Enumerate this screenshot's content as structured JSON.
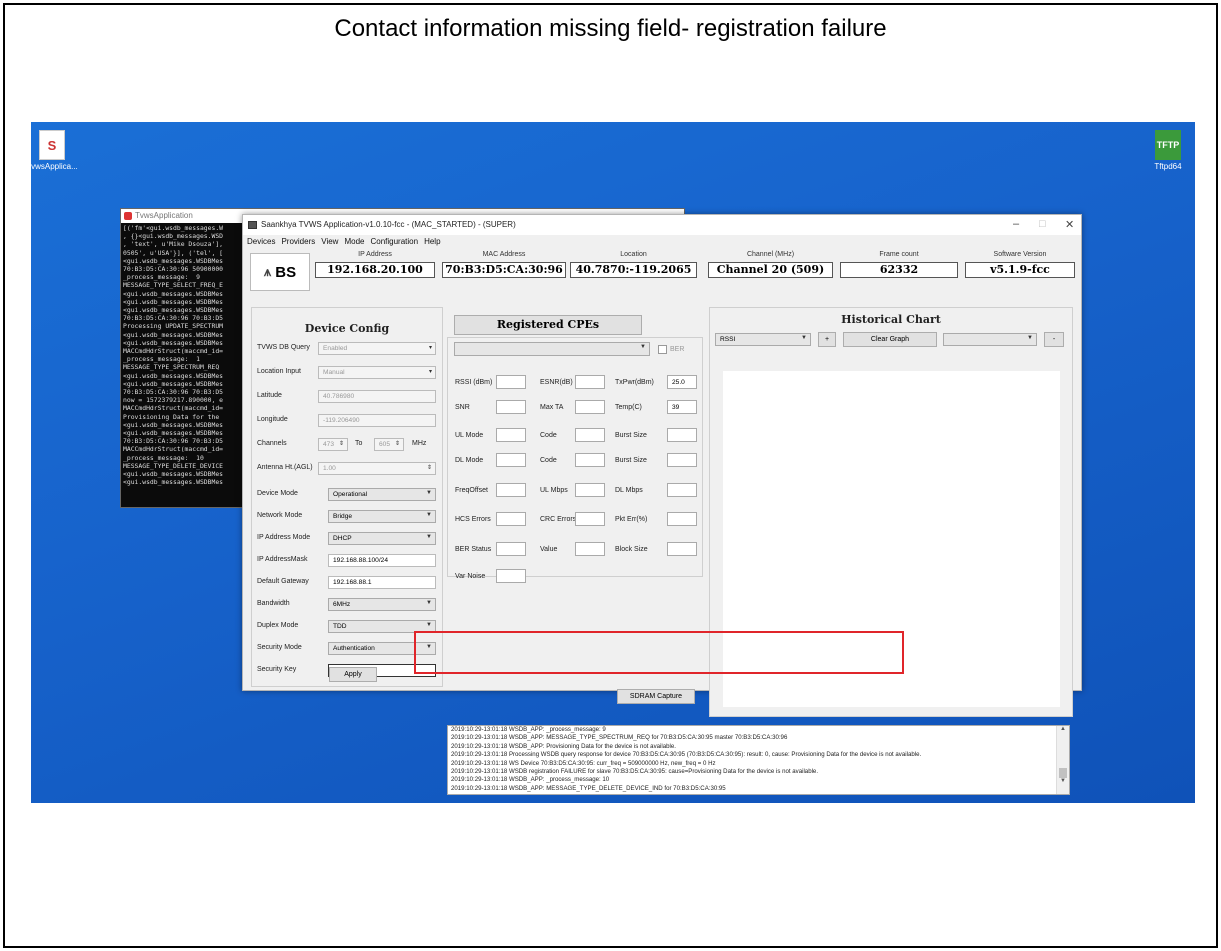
{
  "slide_title": "Contact information missing field- registration failure",
  "desktop": {
    "icons": [
      {
        "label": "TvwsApplica...",
        "icon": "app-icon"
      },
      {
        "label": "Tftpd64",
        "icon": "tftp-icon"
      }
    ]
  },
  "console": {
    "title": "TvwsApplication",
    "lines": [
      "[('fm'<gui.wsdb_messages.W",
      ", {}<gui.wsdb_messages.WSD",
      ", 'text', u'Mike Dsouza'],",
      "0505', u'USA'}], ('tel', [",
      "<gui.wsdb_messages.WSDBMes",
      "70:B3:D5:CA:30:96 50900000",
      "_process_message:  9",
      "MESSAGE_TYPE_SELECT_FREQ_E",
      "<gui.wsdb_messages.WSDBMes",
      "<gui.wsdb_messages.WSDBMes",
      "<gui.wsdb_messages.WSDBMes",
      "70:B3:D5:CA:30:96 70:B3:D5",
      "Processing UPDATE_SPECTRUM",
      "<gui.wsdb_messages.WSDBMes",
      "<gui.wsdb_messages.WSDBMes",
      "MACCmdHdrStruct(maccmd_id=",
      "_process_message:  1",
      "MESSAGE_TYPE_SPECTRUM_REQ",
      "<gui.wsdb_messages.WSDBMes",
      "<gui.wsdb_messages.WSDBMes",
      "70:B3:D5:CA:30:96 70:B3:D5",
      "now = 1572379217.890000, e",
      "MACCmdHdrStruct(maccmd_id=",
      "Provisioning Data for the",
      "<gui.wsdb_messages.WSDBMes",
      "<gui.wsdb_messages.WSDBMes",
      "70:B3:D5:CA:30:96 70:B3:D5",
      "MACCmdHdrStruct(maccmd_id=",
      "_process_message:  10",
      "MESSAGE_TYPE_DELETE_DEVICE",
      "<gui.wsdb_messages.WSDBMes",
      "<gui.wsdb_messages.WSDBMes"
    ]
  },
  "app": {
    "window_title": "Saankhya TVWS Application-v1.0.10-fcc - (MAC_STARTED) - (SUPER)",
    "window_controls": {
      "minimize": "–",
      "maximize": "□",
      "close": "✕"
    },
    "menu": [
      "Devices",
      "Providers",
      "View",
      "Mode",
      "Configuration",
      "Help"
    ],
    "logo_text": "BS",
    "header": [
      {
        "label": "IP Address",
        "value": "192.168.20.100"
      },
      {
        "label": "MAC Address",
        "value": "70:B3:D5:CA:30:96"
      },
      {
        "label": "Location",
        "value": "40.7870:-119.2065"
      },
      {
        "label": "Channel (MHz)",
        "value": "Channel 20 (509)"
      },
      {
        "label": "Frame count",
        "value": "62332"
      },
      {
        "label": "Software Version",
        "value": "v5.1.9-fcc"
      }
    ],
    "device_config": {
      "title": "Device Config",
      "tvws_db_query": {
        "label": "TVWS DB Query",
        "value": "Enabled"
      },
      "location_input": {
        "label": "Location Input",
        "value": "Manual"
      },
      "latitude": {
        "label": "Latitude",
        "value": "40.786980"
      },
      "longitude": {
        "label": "Longitude",
        "value": "-119.206490"
      },
      "channels": {
        "label": "Channels",
        "from": "473",
        "to_label": "To",
        "to": "605",
        "unit": "MHz"
      },
      "antenna": {
        "label": "Antenna Ht.(AGL)",
        "value": "1.00"
      },
      "device_mode": {
        "label": "Device Mode",
        "value": "Operational"
      },
      "network_mode": {
        "label": "Network Mode",
        "value": "Bridge"
      },
      "ip_address_mode": {
        "label": "IP Address Mode",
        "value": "DHCP"
      },
      "ip_address_mask": {
        "label": "IP AddressMask",
        "value": "192.168.88.100/24"
      },
      "default_gateway": {
        "label": "Default Gateway",
        "value": "192.168.88.1"
      },
      "bandwidth": {
        "label": "Bandwidth",
        "value": "6MHz"
      },
      "duplex_mode": {
        "label": "Duplex Mode",
        "value": "TDD"
      },
      "security_mode": {
        "label": "Security Mode",
        "value": "Authentication"
      },
      "security_key": {
        "label": "Security Key",
        "value": "••••••••"
      },
      "apply": "Apply"
    },
    "registered_cpes": {
      "title": "Registered CPEs",
      "ber_label": "BER",
      "stats": {
        "rssi": {
          "label": "RSSI (dBm)",
          "value": ""
        },
        "esnr": {
          "label": "ESNR(dB)",
          "value": ""
        },
        "txpwr": {
          "label": "TxPwr(dBm)",
          "value": "25.0"
        },
        "snr": {
          "label": "SNR",
          "value": ""
        },
        "max_ta": {
          "label": "Max TA",
          "value": ""
        },
        "temp": {
          "label": "Temp(C)",
          "value": "39"
        },
        "ul_mode": {
          "label": "UL Mode",
          "value": ""
        },
        "ul_code": {
          "label": "Code",
          "value": ""
        },
        "ul_burst": {
          "label": "Burst Size",
          "value": ""
        },
        "dl_mode": {
          "label": "DL Mode",
          "value": ""
        },
        "dl_code": {
          "label": "Code",
          "value": ""
        },
        "dl_burst": {
          "label": "Burst Size",
          "value": ""
        },
        "freq_offset": {
          "label": "FreqOffset",
          "value": ""
        },
        "ul_mbps": {
          "label": "UL Mbps",
          "value": ""
        },
        "dl_mbps": {
          "label": "DL Mbps",
          "value": ""
        },
        "hcs_errors": {
          "label": "HCS Errors",
          "value": ""
        },
        "crc_errors": {
          "label": "CRC Errors",
          "value": ""
        },
        "pkt_err": {
          "label": "Pkt Err(%)",
          "value": ""
        },
        "ber_status": {
          "label": "BER Status",
          "value": ""
        },
        "ber_value": {
          "label": "Value",
          "value": ""
        },
        "block_size": {
          "label": "Block Size",
          "value": ""
        },
        "var_noise": {
          "label": "Var Noise",
          "value": ""
        }
      },
      "sdram_capture": "SDRAM Capture"
    },
    "historical_chart": {
      "title": "Historical Chart",
      "metric": "RSSI",
      "add": "+",
      "clear": "Clear Graph",
      "remove": "-"
    },
    "log": [
      "2019:10:29-13:01:18 WSDB_APP: _process_message: 9",
      "2019:10:29-13:01:18 WSDB_APP: MESSAGE_TYPE_SPECTRUM_REQ for  70:B3:D5:CA:30:95  master 70:B3:D5:CA:30:96",
      "2019:10:29-13:01:18 WSDB_APP: Provisioning Data for the device is not available.",
      "2019:10:29-13:01:18 Processing WSDB query response for device 70:B3:D5:CA:30:95 (70:B3:D5:CA:30:95): result: 0, cause: Provisioning Data for the device is not available.",
      "2019:10:29-13:01:18 WS Device 70:B3:D5:CA:30:95: curr_freq = 509000000 Hz, new_freq = 0 Hz",
      "2019:10:29-13:01:18 WSDB registration FAILURE for slave 70:B3:D5:CA:30:95: cause=Provisioning Data for the device is not available.",
      "2019:10:29-13:01:18 WSDB_APP: _process_message: 10",
      "2019:10:29-13:01:18 WSDB_APP: MESSAGE_TYPE_DELETE_DEVICE_IND for  70:B3:D5:CA:30:95"
    ]
  }
}
